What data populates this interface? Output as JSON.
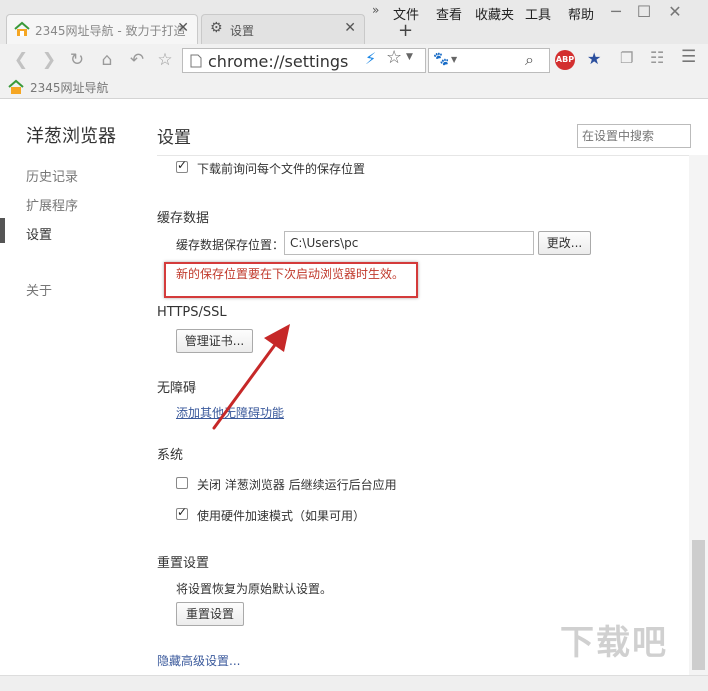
{
  "window": {
    "tabs": [
      {
        "label": "2345网址导航 - 致力于打造",
        "close": "✕"
      },
      {
        "label": "设置",
        "close": "✕"
      }
    ],
    "new_tab": "+",
    "menu_expand": "»",
    "menu": [
      "文件",
      "查看",
      "收藏夹",
      "工具",
      "帮助"
    ],
    "window_buttons": [
      "─",
      "☐",
      "✕"
    ]
  },
  "toolbar": {
    "url": "chrome://settings",
    "search_placeholder": "",
    "adblock_label": "ABP"
  },
  "bookmarks": {
    "items": [
      {
        "label": "2345网址导航"
      }
    ]
  },
  "sidebar": {
    "brand": "洋葱浏览器",
    "items": [
      {
        "label": "历史记录"
      },
      {
        "label": "扩展程序"
      },
      {
        "label": "设置"
      },
      {
        "label": "关于"
      }
    ],
    "active_index": 2
  },
  "header": {
    "title": "设置",
    "search_placeholder": "在设置中搜索"
  },
  "content": {
    "download_ask": {
      "label": "下载前询问每个文件的保存位置",
      "checked": true
    },
    "cache": {
      "title": "缓存数据",
      "path_label": "缓存数据保存位置：",
      "path_value": "C:\\Users\\pc",
      "change_button": "更改...",
      "notice": "新的保存位置要在下次启动浏览器时生效。"
    },
    "https": {
      "title": "HTTPS/SSL",
      "manage_button": "管理证书..."
    },
    "accessibility": {
      "title": "无障碍",
      "link": "添加其他无障碍功能"
    },
    "system": {
      "title": "系统",
      "background_apps": {
        "label": "关闭 洋葱浏览器 后继续运行后台应用",
        "checked": false
      },
      "hardware_accel": {
        "label": "使用硬件加速模式（如果可用）",
        "checked": true
      }
    },
    "reset": {
      "title": "重置设置",
      "description": "将设置恢复为原始默认设置。",
      "button": "重置设置"
    },
    "hide_advanced": "隐藏高级设置..."
  },
  "colors": {
    "highlight_red": "#d43b3b",
    "link_blue": "#3b5a9c",
    "arrow_red": "#c62828"
  },
  "watermark": "下载吧"
}
